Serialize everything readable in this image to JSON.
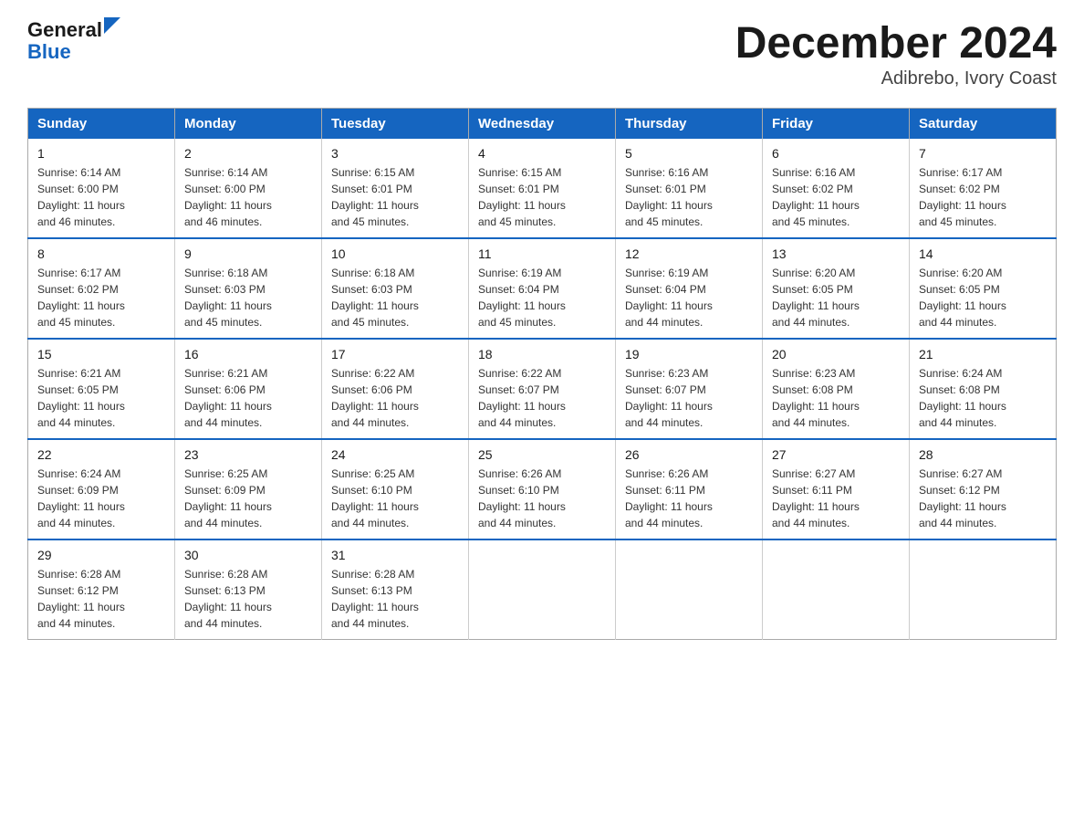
{
  "logo": {
    "general": "General",
    "blue": "Blue",
    "arrow_color": "#1565c0"
  },
  "title": "December 2024",
  "subtitle": "Adibrebo, Ivory Coast",
  "weekdays": [
    "Sunday",
    "Monday",
    "Tuesday",
    "Wednesday",
    "Thursday",
    "Friday",
    "Saturday"
  ],
  "weeks": [
    [
      {
        "day": "1",
        "sunrise": "6:14 AM",
        "sunset": "6:00 PM",
        "daylight": "11 hours and 46 minutes."
      },
      {
        "day": "2",
        "sunrise": "6:14 AM",
        "sunset": "6:00 PM",
        "daylight": "11 hours and 46 minutes."
      },
      {
        "day": "3",
        "sunrise": "6:15 AM",
        "sunset": "6:01 PM",
        "daylight": "11 hours and 45 minutes."
      },
      {
        "day": "4",
        "sunrise": "6:15 AM",
        "sunset": "6:01 PM",
        "daylight": "11 hours and 45 minutes."
      },
      {
        "day": "5",
        "sunrise": "6:16 AM",
        "sunset": "6:01 PM",
        "daylight": "11 hours and 45 minutes."
      },
      {
        "day": "6",
        "sunrise": "6:16 AM",
        "sunset": "6:02 PM",
        "daylight": "11 hours and 45 minutes."
      },
      {
        "day": "7",
        "sunrise": "6:17 AM",
        "sunset": "6:02 PM",
        "daylight": "11 hours and 45 minutes."
      }
    ],
    [
      {
        "day": "8",
        "sunrise": "6:17 AM",
        "sunset": "6:02 PM",
        "daylight": "11 hours and 45 minutes."
      },
      {
        "day": "9",
        "sunrise": "6:18 AM",
        "sunset": "6:03 PM",
        "daylight": "11 hours and 45 minutes."
      },
      {
        "day": "10",
        "sunrise": "6:18 AM",
        "sunset": "6:03 PM",
        "daylight": "11 hours and 45 minutes."
      },
      {
        "day": "11",
        "sunrise": "6:19 AM",
        "sunset": "6:04 PM",
        "daylight": "11 hours and 45 minutes."
      },
      {
        "day": "12",
        "sunrise": "6:19 AM",
        "sunset": "6:04 PM",
        "daylight": "11 hours and 44 minutes."
      },
      {
        "day": "13",
        "sunrise": "6:20 AM",
        "sunset": "6:05 PM",
        "daylight": "11 hours and 44 minutes."
      },
      {
        "day": "14",
        "sunrise": "6:20 AM",
        "sunset": "6:05 PM",
        "daylight": "11 hours and 44 minutes."
      }
    ],
    [
      {
        "day": "15",
        "sunrise": "6:21 AM",
        "sunset": "6:05 PM",
        "daylight": "11 hours and 44 minutes."
      },
      {
        "day": "16",
        "sunrise": "6:21 AM",
        "sunset": "6:06 PM",
        "daylight": "11 hours and 44 minutes."
      },
      {
        "day": "17",
        "sunrise": "6:22 AM",
        "sunset": "6:06 PM",
        "daylight": "11 hours and 44 minutes."
      },
      {
        "day": "18",
        "sunrise": "6:22 AM",
        "sunset": "6:07 PM",
        "daylight": "11 hours and 44 minutes."
      },
      {
        "day": "19",
        "sunrise": "6:23 AM",
        "sunset": "6:07 PM",
        "daylight": "11 hours and 44 minutes."
      },
      {
        "day": "20",
        "sunrise": "6:23 AM",
        "sunset": "6:08 PM",
        "daylight": "11 hours and 44 minutes."
      },
      {
        "day": "21",
        "sunrise": "6:24 AM",
        "sunset": "6:08 PM",
        "daylight": "11 hours and 44 minutes."
      }
    ],
    [
      {
        "day": "22",
        "sunrise": "6:24 AM",
        "sunset": "6:09 PM",
        "daylight": "11 hours and 44 minutes."
      },
      {
        "day": "23",
        "sunrise": "6:25 AM",
        "sunset": "6:09 PM",
        "daylight": "11 hours and 44 minutes."
      },
      {
        "day": "24",
        "sunrise": "6:25 AM",
        "sunset": "6:10 PM",
        "daylight": "11 hours and 44 minutes."
      },
      {
        "day": "25",
        "sunrise": "6:26 AM",
        "sunset": "6:10 PM",
        "daylight": "11 hours and 44 minutes."
      },
      {
        "day": "26",
        "sunrise": "6:26 AM",
        "sunset": "6:11 PM",
        "daylight": "11 hours and 44 minutes."
      },
      {
        "day": "27",
        "sunrise": "6:27 AM",
        "sunset": "6:11 PM",
        "daylight": "11 hours and 44 minutes."
      },
      {
        "day": "28",
        "sunrise": "6:27 AM",
        "sunset": "6:12 PM",
        "daylight": "11 hours and 44 minutes."
      }
    ],
    [
      {
        "day": "29",
        "sunrise": "6:28 AM",
        "sunset": "6:12 PM",
        "daylight": "11 hours and 44 minutes."
      },
      {
        "day": "30",
        "sunrise": "6:28 AM",
        "sunset": "6:13 PM",
        "daylight": "11 hours and 44 minutes."
      },
      {
        "day": "31",
        "sunrise": "6:28 AM",
        "sunset": "6:13 PM",
        "daylight": "11 hours and 44 minutes."
      },
      null,
      null,
      null,
      null
    ]
  ],
  "labels": {
    "sunrise": "Sunrise:",
    "sunset": "Sunset:",
    "daylight": "Daylight:"
  }
}
